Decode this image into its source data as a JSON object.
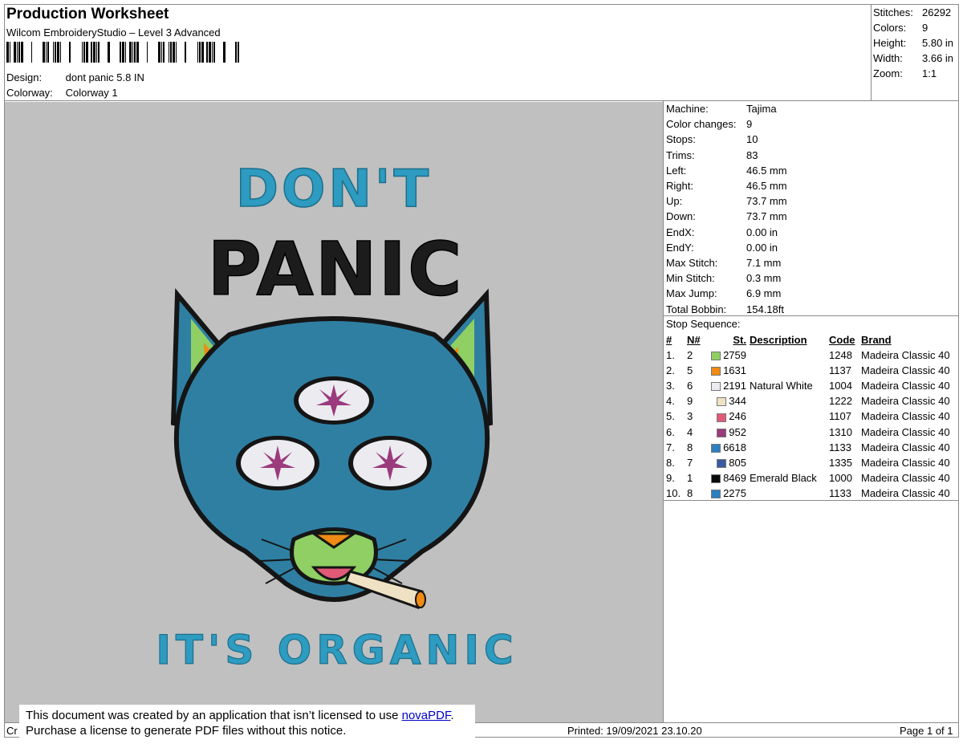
{
  "header": {
    "title": "Production Worksheet",
    "software": "Wilcom EmbroideryStudio – Level 3 Advanced",
    "design_label": "Design:",
    "design_value": "dont panic 5.8 IN",
    "colorway_label": "Colorway:",
    "colorway_value": "Colorway 1"
  },
  "stats": [
    {
      "label": "Stitches:",
      "value": "26292"
    },
    {
      "label": "Colors:",
      "value": "9"
    },
    {
      "label": "Height:",
      "value": "5.80 in"
    },
    {
      "label": "Width:",
      "value": "3.66 in"
    },
    {
      "label": "Zoom:",
      "value": "1:1"
    }
  ],
  "machine_info": [
    {
      "label": "Machine:",
      "value": "Tajima"
    },
    {
      "label": "Color changes:",
      "value": "9"
    },
    {
      "label": "Stops:",
      "value": "10"
    },
    {
      "label": "Trims:",
      "value": "83"
    },
    {
      "label": "Left:",
      "value": "46.5 mm"
    },
    {
      "label": "Right:",
      "value": "46.5 mm"
    },
    {
      "label": "Up:",
      "value": "73.7 mm"
    },
    {
      "label": "Down:",
      "value": "73.7 mm"
    },
    {
      "label": "EndX:",
      "value": "0.00 in"
    },
    {
      "label": "EndY:",
      "value": "0.00 in"
    },
    {
      "label": "Max Stitch:",
      "value": "7.1 mm"
    },
    {
      "label": "Min Stitch:",
      "value": "0.3 mm"
    },
    {
      "label": "Max Jump:",
      "value": "6.9 mm"
    },
    {
      "label": "Total Bobbin:",
      "value": "154.18ft"
    }
  ],
  "stop_sequence": {
    "title": "Stop Sequence:",
    "headers": [
      "#",
      "N#",
      "St.",
      "Description",
      "Code",
      "Brand"
    ],
    "rows": [
      {
        "idx": "1.",
        "n": "2",
        "color": "#8fcf63",
        "st": "2759",
        "desc": "",
        "code": "1248",
        "brand": "Madeira Classic 40"
      },
      {
        "idx": "2.",
        "n": "5",
        "color": "#ef8a14",
        "st": "1631",
        "desc": "",
        "code": "1137",
        "brand": "Madeira Classic 40"
      },
      {
        "idx": "3.",
        "n": "6",
        "color": "#ecebf0",
        "st": "2191",
        "desc": "Natural White",
        "code": "1004",
        "brand": "Madeira Classic 40"
      },
      {
        "idx": "4.",
        "n": "9",
        "color": "#efe2c4",
        "st": "344",
        "desc": "",
        "code": "1222",
        "brand": "Madeira Classic 40"
      },
      {
        "idx": "5.",
        "n": "3",
        "color": "#e05a78",
        "st": "246",
        "desc": "",
        "code": "1107",
        "brand": "Madeira Classic 40"
      },
      {
        "idx": "6.",
        "n": "4",
        "color": "#9b3a7c",
        "st": "952",
        "desc": "",
        "code": "1310",
        "brand": "Madeira Classic 40"
      },
      {
        "idx": "7.",
        "n": "8",
        "color": "#2c7fc0",
        "st": "6618",
        "desc": "",
        "code": "1133",
        "brand": "Madeira Classic 40"
      },
      {
        "idx": "8.",
        "n": "7",
        "color": "#3b5aa3",
        "st": "805",
        "desc": "",
        "code": "1335",
        "brand": "Madeira Classic 40"
      },
      {
        "idx": "9.",
        "n": "1",
        "color": "#0a0a0a",
        "st": "8469",
        "desc": "Emerald Black",
        "code": "1000",
        "brand": "Madeira Classic 40"
      },
      {
        "idx": "10.",
        "n": "8",
        "color": "#2c7fc0",
        "st": "2275",
        "desc": "",
        "code": "1133",
        "brand": "Madeira Classic 40"
      }
    ]
  },
  "artwork": {
    "text_top": "DON'T",
    "text_mid": "PANIC",
    "text_bottom": "IT'S ORGANIC"
  },
  "footer": {
    "left": "Cr",
    "printed": "Printed: 19/09/2021 23.10.20",
    "page": "Page 1 of 1"
  },
  "notice": {
    "line1_prefix": "This document was created by an application that isn’t licensed to use ",
    "link": "novaPDF",
    "line1_suffix": ".",
    "line2": "Purchase a license to generate PDF files without this notice."
  },
  "colors": {
    "preview_bg": "#c0c0c0",
    "teal": "#2e9bc0",
    "cat_blue": "#2f7fa3",
    "black_thread": "#1a1a1a"
  }
}
